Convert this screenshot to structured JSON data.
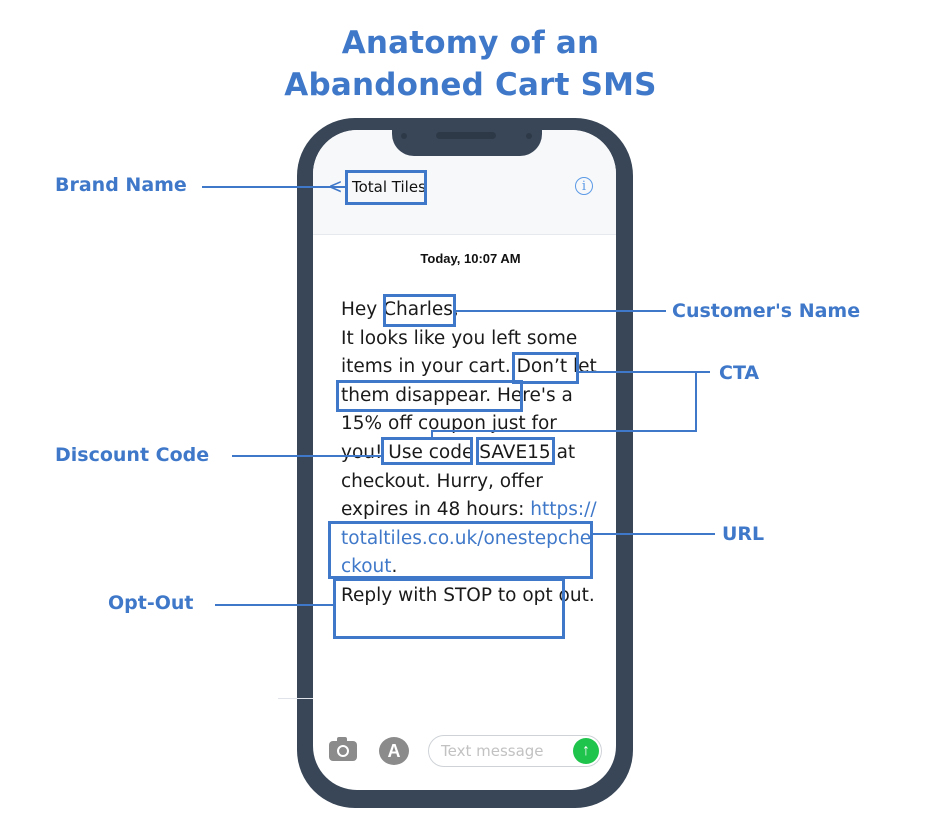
{
  "title": {
    "line1": "Anatomy of an",
    "line2": "Abandoned Cart SMS"
  },
  "phone": {
    "header": {
      "back_icon": "chevron-left-icon",
      "back_glyph": "<",
      "contact_name": "Total Tiles",
      "info_icon": "info-icon",
      "info_glyph": "i"
    },
    "timestamp": "Today, 10:07 AM",
    "message": {
      "greeting": "Hey ",
      "customer_name": "Charles",
      "after_name": ",",
      "line_a": "It looks like you left some items in your cart. ",
      "cta": "Don’t let them disappear.",
      "line_b": " Here's a 15% off coupon just for you! ",
      "use_code": "Use code",
      "space": " ",
      "code": "SAVE15",
      "line_c": " at checkout. Hurry, offer expires in 48 hours: ",
      "url": "https://totaltiles.co.uk/onestepcheckout",
      "after_url": ".",
      "opt_out": "Reply with STOP to opt out."
    },
    "composer": {
      "camera_icon": "camera-icon",
      "appstore_icon": "app-store-icon",
      "appstore_glyph": "A",
      "placeholder": "Text message",
      "send_icon": "send-arrow-icon",
      "send_glyph": "↑"
    }
  },
  "annotations": {
    "brand_name": "Brand Name",
    "customers_name": "Customer's Name",
    "cta": "CTA",
    "discount_code": "Discount Code",
    "url": "URL",
    "opt_out": "Opt-Out"
  },
  "colors": {
    "accent": "#3f78c9",
    "phone_frame": "#394657",
    "send_button": "#1fc44c"
  }
}
